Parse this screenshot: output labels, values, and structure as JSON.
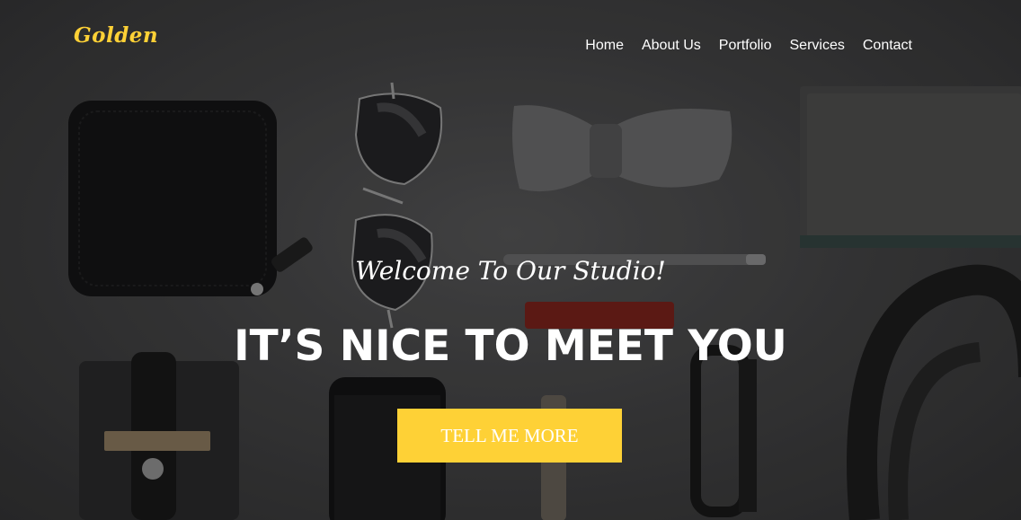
{
  "brand": {
    "logo_text": "Golden",
    "accent_color": "#fed136"
  },
  "nav": {
    "items": [
      {
        "label": "Home"
      },
      {
        "label": "About Us"
      },
      {
        "label": "Portfolio"
      },
      {
        "label": "Services"
      },
      {
        "label": "Contact"
      }
    ]
  },
  "hero": {
    "lead_text": "Welcome To Our Studio!",
    "heading_text": "IT’S NICE TO MEET YOU",
    "cta_label": "TELL ME MORE"
  }
}
